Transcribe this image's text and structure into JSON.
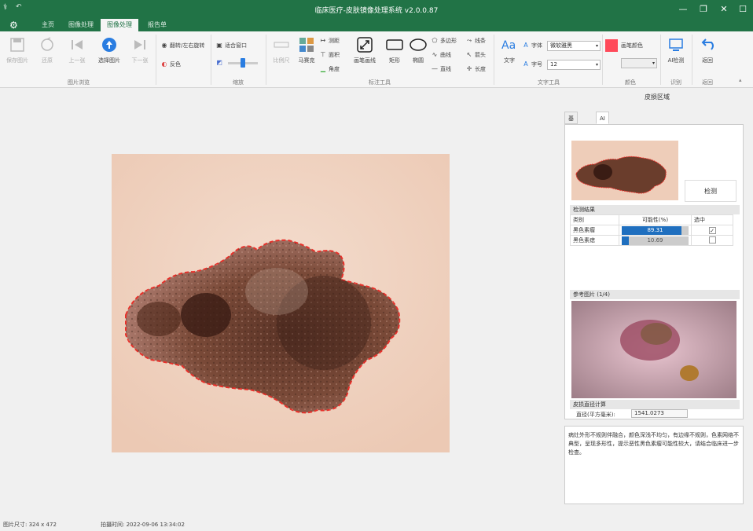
{
  "window": {
    "title": "临床医疗-皮肤镜像处理系统 v2.0.0.87",
    "minimize": "—",
    "restore": "❐",
    "close": "✕"
  },
  "tabs": [
    "主页",
    "图像处理",
    "图像处理",
    "报告单"
  ],
  "active_tab": 2,
  "ribbon": {
    "groups": {
      "image_browse": "图片浏览",
      "zoom": "缩放",
      "annotation": "标注工具",
      "text": "文字工具",
      "color": "颜色",
      "ai": "识别",
      "back": "返回"
    },
    "buttons": {
      "save_image": "保存图片",
      "restore": "还原",
      "prev": "上一张",
      "select_image": "选择图片",
      "next": "下一张",
      "flip": "翻转/左右旋转",
      "reverse": "反色",
      "fit_window": "适合窗口",
      "ruler": "比例尺",
      "mosaic": "马赛克",
      "measure": "测距",
      "area": "面积",
      "angle": "角度",
      "pen": "画笔画线",
      "rect": "矩形",
      "ellipse": "椭圆",
      "polygon": "多边形",
      "curve": "曲线",
      "line": "直线",
      "free": "线条",
      "arrow": "箭头",
      "length": "长度",
      "text": "文字",
      "font_label": "字体",
      "font_value": "微软雅黑",
      "size_label": "字号",
      "size_value": "12",
      "pen_color": "画笔颜色",
      "ai_detect": "AI检测",
      "back": "返回"
    }
  },
  "panel": {
    "title": "皮损区域",
    "tab_info": "基础资料",
    "tab_ai": "AI检测",
    "detect_button": "检测",
    "result_header": "检测结果",
    "col_type": "类别",
    "col_prob": "可能性(%)",
    "col_select": "选中",
    "rows": [
      {
        "name": "黑色素瘤",
        "prob": 89.31,
        "label": "89.31",
        "checked": "✓"
      },
      {
        "name": "黑色素痣",
        "prob": 10.69,
        "label": "10.69",
        "checked": ""
      }
    ],
    "ref_header": "参考图片 (1/4)",
    "measure_header": "皮损直径计算",
    "diameter_label": "直径(平方毫米):",
    "diameter_value": "1541.0273",
    "description": "病灶外形不规则伴融合，颜色深浅不均匀，有边缘不规则，色素网络不典型，呈现多形性，提示恶性黑色素瘤可能性较大，请结合临床进一步检查。"
  },
  "status": {
    "image_size": "图片尺寸: 324 x 472",
    "capture_time": "拍摄时间: 2022-09-06 13:34:02"
  },
  "colors": {
    "accent": "#217346",
    "pen_color": "#ff4a5a",
    "bar_fill": "#1f6fbf",
    "outline": "#e8302a"
  }
}
